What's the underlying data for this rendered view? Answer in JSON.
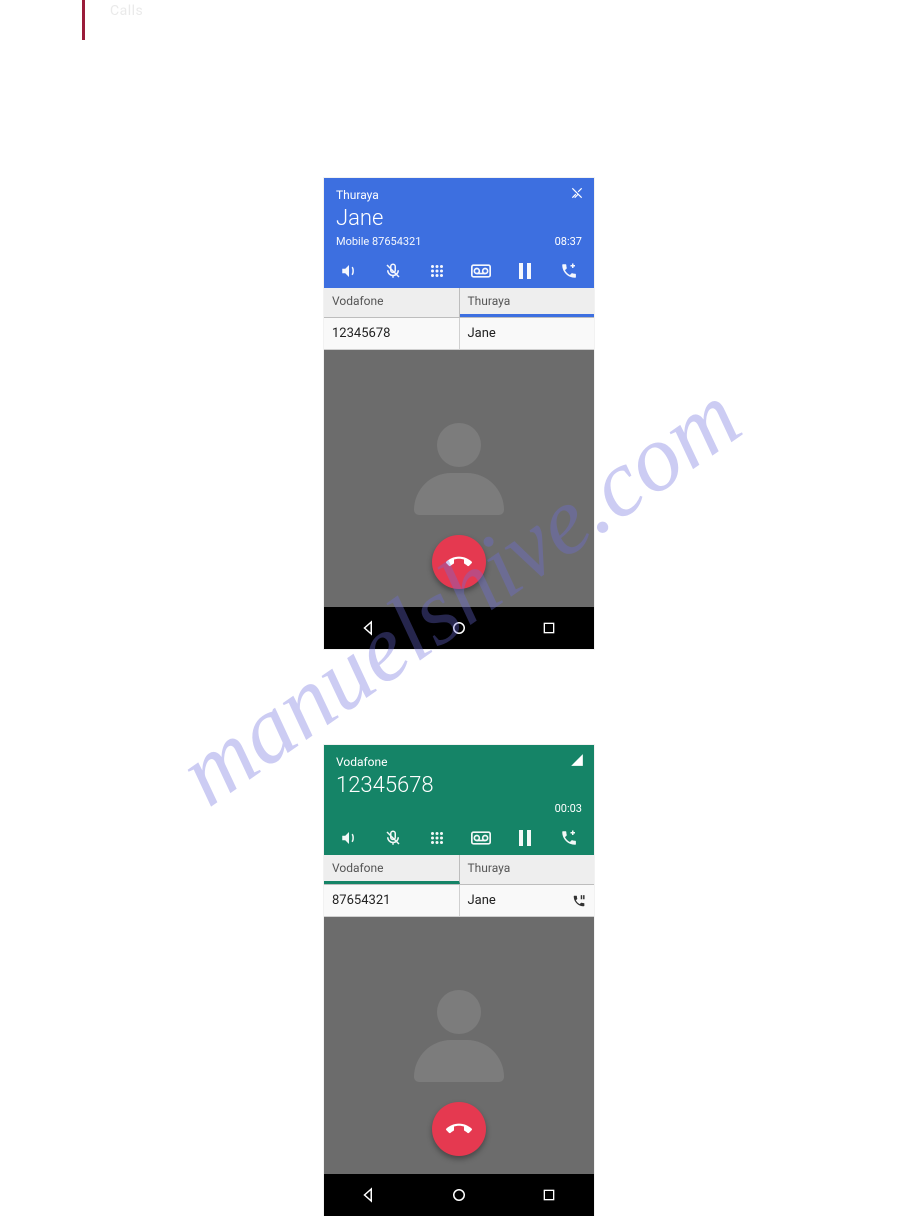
{
  "page": {
    "header_label": "Calls",
    "watermark": "manuelshive.com"
  },
  "screens": [
    {
      "theme": "blue",
      "carrier": "Thuraya",
      "caller_name": "Jane",
      "caller_sub": "Mobile 87654321",
      "duration": "08:37",
      "tabs": [
        {
          "carrier": "Vodafone",
          "value": "12345678",
          "active": false,
          "has_icon": false
        },
        {
          "carrier": "Thuraya",
          "value": "Jane",
          "active": true,
          "has_icon": false
        }
      ]
    },
    {
      "theme": "teal",
      "carrier": "Vodafone",
      "caller_name": "12345678",
      "caller_sub": "",
      "duration": "00:03",
      "tabs": [
        {
          "carrier": "Vodafone",
          "value": "87654321",
          "active": true,
          "has_icon": false
        },
        {
          "carrier": "Thuraya",
          "value": "Jane",
          "active": false,
          "has_icon": true
        }
      ]
    }
  ]
}
